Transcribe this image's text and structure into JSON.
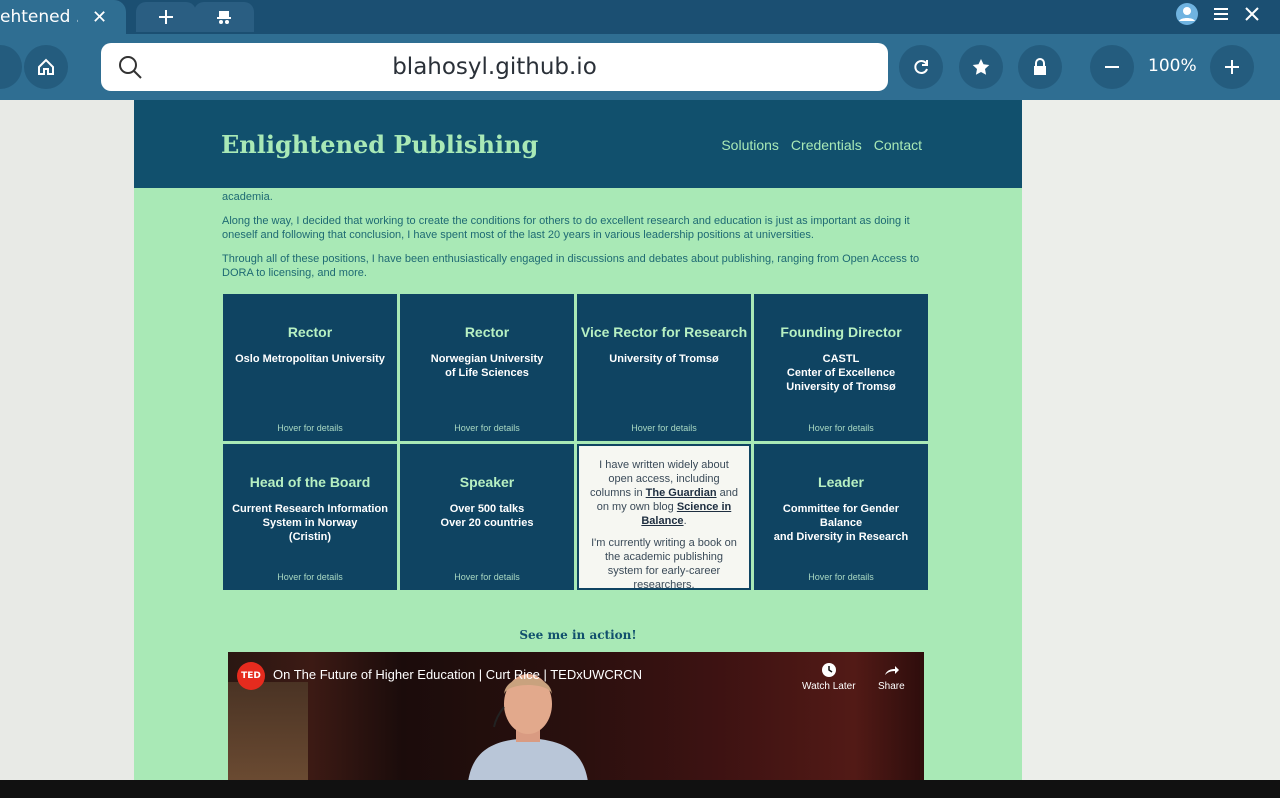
{
  "browser": {
    "tab_title": "ehtened ...",
    "url": "blahosyl.github.io",
    "zoom": "100%",
    "icons": [
      "close-icon",
      "plus-icon",
      "incognito-icon",
      "home-icon",
      "search-icon",
      "reload-icon",
      "star-icon",
      "lock-icon",
      "zoom-out-icon",
      "zoom-in-icon",
      "avatar-icon",
      "menu-icon"
    ]
  },
  "site": {
    "title": "Enlightened Publishing",
    "nav": [
      "Solutions",
      "Credentials",
      "Contact"
    ],
    "paragraphs": [
      "academia.",
      "Along the way, I decided that working to create the conditions for others to do excellent research and education is just as important as doing it oneself and following that conclusion, I have spent most of the last 20 years in various leadership positions at universities.",
      "Through all of these positions, I have been enthusiastically engaged in discussions and debates about publishing, ranging from Open Access to DORA to licensing, and more."
    ],
    "cards": [
      {
        "title": "Rector",
        "sub": "Oslo Metropolitan University",
        "hover": "Hover for details"
      },
      {
        "title": "Rector",
        "sub": "Norwegian University\nof Life Sciences",
        "hover": "Hover for details"
      },
      {
        "title": "Vice Rector for Research",
        "sub": "University of Tromsø",
        "hover": "Hover for details"
      },
      {
        "title": "Founding Director",
        "sub": "CASTL\nCenter of Excellence\nUniversity of Tromsø",
        "hover": "Hover for details"
      },
      {
        "title": "Head of the Board",
        "sub": "Current Research Information\nSystem in Norway\n(Cristin)",
        "hover": "Hover for details"
      },
      {
        "title": "Speaker",
        "sub": "Over 500 talks\nOver 20 countries",
        "hover": "Hover for details"
      },
      {
        "title": "Leader",
        "sub": "Committee for Gender\nBalance\nand Diversity in Research",
        "hover": "Hover for details"
      }
    ],
    "open_card": {
      "p1_a": "I have written widely about open access, including columns in ",
      "link1": "The Guardian",
      "p1_b": " and on my own blog ",
      "link2": "Science in Balance",
      "p1_c": ".",
      "p2": "I'm currently writing a book on the academic publishing system for early-career researchers."
    },
    "action_title": "See me in action!",
    "video": {
      "logo": "TED",
      "title": "On The Future of Higher Education | Curt Rice | TEDxUWCRCN",
      "watch_later": "Watch Later",
      "share": "Share"
    }
  }
}
